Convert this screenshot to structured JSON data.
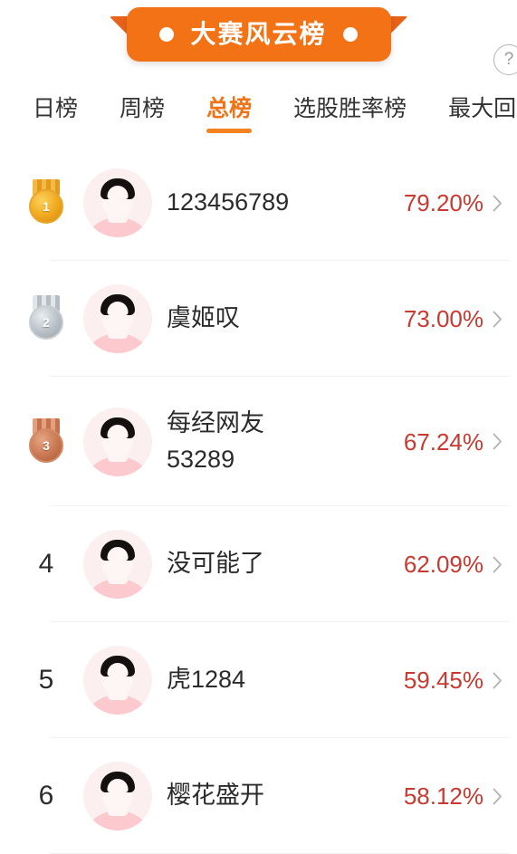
{
  "header": {
    "banner_title": "大赛风云榜",
    "help_icon": "question-mark-circle-icon",
    "banner_color": "#f47216"
  },
  "tabs": [
    {
      "label": "日榜",
      "active": false
    },
    {
      "label": "周榜",
      "active": false
    },
    {
      "label": "总榜",
      "active": true
    },
    {
      "label": "选股胜率榜",
      "active": false
    },
    {
      "label": "最大回",
      "active": false
    }
  ],
  "leaderboard": {
    "accent_color": "#f58220",
    "value_color": "#c9392f",
    "rows": [
      {
        "rank": "1",
        "medal": "gold",
        "name_line1": "123456789",
        "name_line2": "",
        "value": "79.20%"
      },
      {
        "rank": "2",
        "medal": "silver",
        "name_line1": "虞姬叹",
        "name_line2": "",
        "value": "73.00%"
      },
      {
        "rank": "3",
        "medal": "bronze",
        "name_line1": "每经网友",
        "name_line2": "53289",
        "value": "67.24%"
      },
      {
        "rank": "4",
        "medal": "",
        "name_line1": "没可能了",
        "name_line2": "",
        "value": "62.09%"
      },
      {
        "rank": "5",
        "medal": "",
        "name_line1": "虎1284",
        "name_line2": "",
        "value": "59.45%"
      },
      {
        "rank": "6",
        "medal": "",
        "name_line1": "樱花盛开",
        "name_line2": "",
        "value": "58.12%"
      }
    ]
  }
}
